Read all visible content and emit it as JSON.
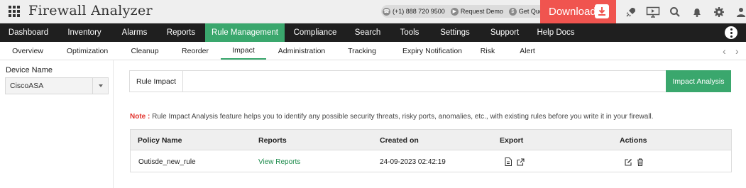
{
  "app": {
    "title": "Firewall Analyzer"
  },
  "header": {
    "phone": "(+1) 888 720 9500",
    "request_demo": "Request Demo",
    "get_quote": "Get Quote",
    "download": "Download",
    "icons": [
      "rocket-icon",
      "presentation-icon",
      "search-icon",
      "bell-icon",
      "gear-icon",
      "user-icon"
    ]
  },
  "main_nav": [
    {
      "label": "Dashboard"
    },
    {
      "label": "Inventory"
    },
    {
      "label": "Alarms"
    },
    {
      "label": "Reports"
    },
    {
      "label": "Rule Management",
      "active": true
    },
    {
      "label": "Compliance"
    },
    {
      "label": "Search"
    },
    {
      "label": "Tools"
    },
    {
      "label": "Settings"
    },
    {
      "label": "Support"
    },
    {
      "label": "Help Docs"
    }
  ],
  "sub_nav": [
    {
      "label": "Overview"
    },
    {
      "label": "Optimization"
    },
    {
      "label": "Cleanup"
    },
    {
      "label": "Reorder"
    },
    {
      "label": "Impact",
      "active": true
    },
    {
      "label": "Administration"
    },
    {
      "label": "Tracking"
    },
    {
      "label": "Expiry Notification"
    },
    {
      "label": "Risk"
    },
    {
      "label": "Alert"
    }
  ],
  "sidebar": {
    "device_label": "Device Name",
    "device_value": "CiscoASA"
  },
  "rule_impact": {
    "label": "Rule Impact",
    "input_value": "",
    "button": "Impact Analysis"
  },
  "note": {
    "prefix": "Note :",
    "text": "Rule Impact Analysis feature helps you to identify any possible security threats, risky ports, anomalies, etc., with existing rules before you write it in your firewall."
  },
  "table": {
    "columns": [
      "Policy Name",
      "Reports",
      "Created on",
      "Export",
      "Actions"
    ],
    "rows": [
      {
        "policy_name": "Outisde_new_rule",
        "reports": "View Reports",
        "created_on": "24-09-2023 02:42:19"
      }
    ]
  },
  "colors": {
    "accent_green": "#3aa76d",
    "download_red": "#f0544f",
    "nav_dark": "#1f1f1f",
    "note_red": "#e2312b"
  }
}
